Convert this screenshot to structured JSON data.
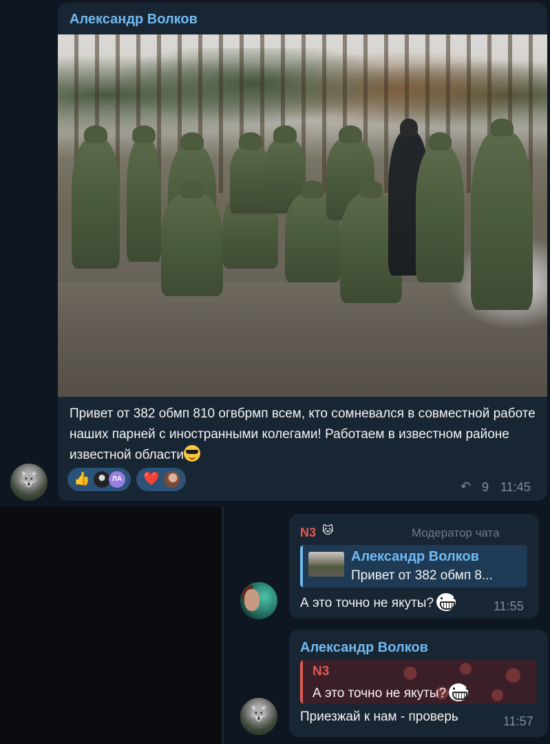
{
  "message1": {
    "sender": "Александр Волков",
    "text": "Привет от 382 обмп 810 огвбрмп всем, кто сомневался в совместной работе наших парней с иностранными колегами! Работаем в известном районе известной области",
    "reactions": [
      {
        "emoji": "👍",
        "avatar_initials": "ЛА"
      },
      {
        "emoji": "❤️"
      }
    ],
    "forwards": "9",
    "time": "11:45"
  },
  "message2": {
    "sender": "N3",
    "badge": "Модератор чата",
    "reply": {
      "name": "Александр Волков",
      "text": "Привет от 382 обмп 8..."
    },
    "text": "А это точно не якуты?",
    "time": "11:55"
  },
  "message3": {
    "sender": "Александр Волков",
    "reply": {
      "name": "N3",
      "text": "А это точно не якуты?"
    },
    "text": "Приезжай к нам - проверь",
    "time": "11:57"
  },
  "icons": {
    "forward": "forward-arrow-icon",
    "sticker_emoji": "grinning-face-emoji",
    "cool_emoji": "sunglasses-face-emoji"
  },
  "colors": {
    "background": "#0e1621",
    "bubble": "#182533",
    "name_blue": "#71baf1",
    "name_red": "#e05a52",
    "reaction_bg": "#2b5278"
  }
}
